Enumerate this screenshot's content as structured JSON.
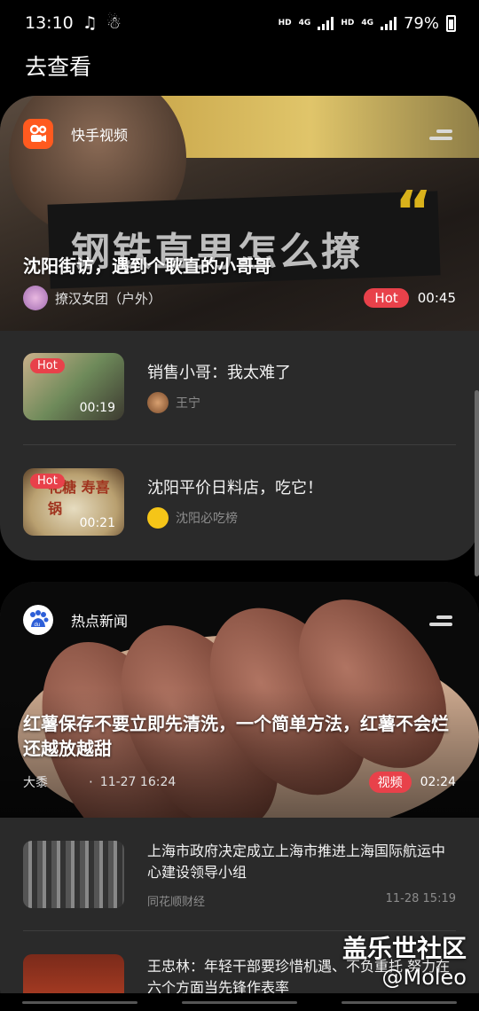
{
  "status_bar": {
    "time": "13:10",
    "battery": "79%",
    "net1": "HD",
    "net2": "HD",
    "lte": "4G"
  },
  "page": {
    "title": "去查看"
  },
  "kuaishou_card": {
    "app_name": "快手视频",
    "hero": {
      "banner_text": "钢铁直男怎么撩",
      "title": "沈阳街访，遇到个耿直的小哥哥",
      "author": "撩汉女团（户外）",
      "badge": "Hot",
      "duration": "00:45"
    },
    "items": [
      {
        "title": "销售小哥：我太难了",
        "source": "王宁",
        "badge": "Hot",
        "duration": "00:19"
      },
      {
        "title": "沈阳平价日料店，吃它！",
        "source": "沈阳必吃榜",
        "badge": "Hot",
        "duration": "00:21",
        "thumb_text": "花糖 寿喜锅"
      }
    ]
  },
  "baidu_card": {
    "app_name": "热点新闻",
    "hero": {
      "title": "红薯保存不要立即先清洗，一个简单方法，红薯不会烂还越放越甜",
      "author": "大黍",
      "time": "11-27 16:24",
      "badge": "视频",
      "duration": "02:24"
    },
    "items": [
      {
        "title": "上海市政府决定成立上海市推进上海国际航运中心建设领导小组",
        "source": "同花顺财经",
        "time": "11-28 15:19"
      },
      {
        "title": "王忠林：年轻干部要珍惜机遇、不负重托 努力在六个方面当先锋作表率",
        "source": "",
        "time": ""
      }
    ]
  },
  "watermark": {
    "line1": "盖乐世社区",
    "line2": "@Moleo"
  },
  "colors": {
    "hot": "#e8414a",
    "card_bg": "#2a2a2a",
    "kuaishou": "#ff5a1f"
  }
}
